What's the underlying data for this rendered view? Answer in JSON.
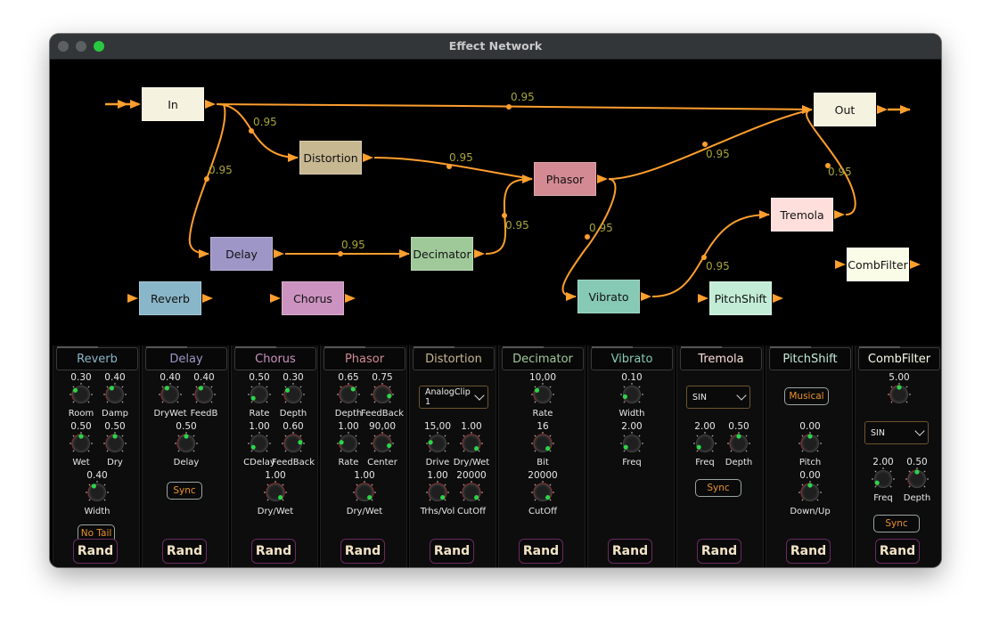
{
  "window": {
    "title": "Effect Network"
  },
  "graph": {
    "edge_color": "#ff9f2e",
    "weight_color": "#a9a53a",
    "nodes": [
      {
        "id": "In",
        "label": "In",
        "color": "#f6f2e0"
      },
      {
        "id": "Out",
        "label": "Out",
        "color": "#f6f2e0"
      },
      {
        "id": "Distortion",
        "label": "Distortion",
        "color": "#c8b892"
      },
      {
        "id": "Phasor",
        "label": "Phasor",
        "color": "#d38a93"
      },
      {
        "id": "Tremola",
        "label": "Tremola",
        "color": "#ffdfdc"
      },
      {
        "id": "Delay",
        "label": "Delay",
        "color": "#9f96c8"
      },
      {
        "id": "Decimator",
        "label": "Decimator",
        "color": "#a0c99a"
      },
      {
        "id": "CombFilter",
        "label": "CombFilter",
        "color": "#fbfce8"
      },
      {
        "id": "Reverb",
        "label": "Reverb",
        "color": "#89b6c9"
      },
      {
        "id": "Chorus",
        "label": "Chorus",
        "color": "#cc93c0"
      },
      {
        "id": "Vibrato",
        "label": "Vibrato",
        "color": "#86c9b4"
      },
      {
        "id": "PitchShift",
        "label": "PitchShift",
        "color": "#c3ecd7"
      }
    ],
    "edges": [
      {
        "from": "In",
        "to": "Out",
        "weight": "0.95"
      },
      {
        "from": "In",
        "to": "Distortion",
        "weight": "0.95"
      },
      {
        "from": "In",
        "to": "Delay",
        "weight": "0.95"
      },
      {
        "from": "Distortion",
        "to": "Phasor",
        "weight": "0.95"
      },
      {
        "from": "Delay",
        "to": "Decimator",
        "weight": "0.95"
      },
      {
        "from": "Decimator",
        "to": "Phasor",
        "weight": "0.95"
      },
      {
        "from": "Phasor",
        "to": "Out",
        "weight": "0.95"
      },
      {
        "from": "Phasor",
        "to": "Vibrato",
        "weight": "0.95"
      },
      {
        "from": "Vibrato",
        "to": "Tremola",
        "weight": "0.95"
      },
      {
        "from": "Tremola",
        "to": "Out",
        "weight": "0.95"
      }
    ]
  },
  "panels": [
    {
      "title": "Reverb",
      "color": "#89b6c9",
      "knobs": [
        {
          "label": "Room",
          "value": "0.30",
          "norm": 0.3
        },
        {
          "label": "Damp",
          "value": "0.40",
          "norm": 0.4
        },
        {
          "label": "Wet",
          "value": "0.50",
          "norm": 0.5
        },
        {
          "label": "Dry",
          "value": "0.50",
          "norm": 0.5
        },
        {
          "label": "Width",
          "value": "0.40",
          "norm": 0.4
        }
      ],
      "toggle": "No Tail",
      "rand": "Rand"
    },
    {
      "title": "Delay",
      "color": "#9f96c8",
      "knobs": [
        {
          "label": "DryWet",
          "value": "0.40",
          "norm": 0.4
        },
        {
          "label": "FeedB",
          "value": "0.40",
          "norm": 0.4
        },
        {
          "label": "Delay",
          "value": "0.50",
          "norm": 0.5
        }
      ],
      "toggle": "Sync",
      "rand": "Rand"
    },
    {
      "title": "Chorus",
      "color": "#cc93c0",
      "knobs": [
        {
          "label": "Rate",
          "value": "0.50",
          "norm": 0.05
        },
        {
          "label": "Depth",
          "value": "0.30",
          "norm": 0.3
        },
        {
          "label": "CDelay",
          "value": "1.00",
          "norm": 0.05
        },
        {
          "label": "FeedBack",
          "value": "0.60",
          "norm": 0.8
        },
        {
          "label": "Dry/Wet",
          "value": "1.00",
          "norm": 1.0
        }
      ],
      "rand": "Rand"
    },
    {
      "title": "Phasor",
      "color": "#d38a93",
      "knobs": [
        {
          "label": "Depth",
          "value": "0.65",
          "norm": 0.65
        },
        {
          "label": "FeedBack",
          "value": "0.75",
          "norm": 0.88
        },
        {
          "label": "Rate",
          "value": "1.00",
          "norm": 0.2
        },
        {
          "label": "Center",
          "value": "90,00",
          "norm": 0.9
        },
        {
          "label": "Dry/Wet",
          "value": "1.00",
          "norm": 1.0
        }
      ],
      "rand": "Rand"
    },
    {
      "title": "Distortion",
      "color": "#c8b892",
      "select": "AnalogClip 1",
      "knobs": [
        {
          "label": "Drive",
          "value": "15,00",
          "norm": 0.2
        },
        {
          "label": "Dry/Wet",
          "value": "1.00",
          "norm": 1.0
        },
        {
          "label": "Trhs/Vol",
          "value": "1.00",
          "norm": 1.0
        },
        {
          "label": "CutOff",
          "value": "20000",
          "norm": 1.0
        }
      ],
      "rand": "Rand"
    },
    {
      "title": "Decimator",
      "color": "#a0c99a",
      "knobs": [
        {
          "label": "Rate",
          "value": "10,00",
          "norm": 0.3
        },
        {
          "label": "Bit",
          "value": "16",
          "norm": 1.0
        },
        {
          "label": "CutOff",
          "value": "20000",
          "norm": 1.0
        }
      ],
      "rand": "Rand"
    },
    {
      "title": "Vibrato",
      "color": "#86c9b4",
      "knobs": [
        {
          "label": "Width",
          "value": "0.10",
          "norm": 0.1
        },
        {
          "label": "Freq",
          "value": "2.00",
          "norm": 0.05
        }
      ],
      "rand": "Rand"
    },
    {
      "title": "Tremola",
      "color": "#ffdfdc",
      "select": "SIN",
      "knobs": [
        {
          "label": "Freq",
          "value": "2.00",
          "norm": 0.05
        },
        {
          "label": "Depth",
          "value": "0.50",
          "norm": 0.5
        }
      ],
      "toggle": "Sync",
      "rand": "Rand"
    },
    {
      "title": "PitchShift",
      "color": "#c3ecd7",
      "toggle": "Musical",
      "knobs": [
        {
          "label": "Pitch",
          "value": "0.00",
          "norm": 0.5
        },
        {
          "label": "Down/Up",
          "value": "0.00",
          "norm": 0.5
        }
      ],
      "rand": "Rand"
    },
    {
      "title": "CombFilter",
      "color": "#fbfce8",
      "knobs": [
        {
          "label": "",
          "value": "5.00",
          "norm": 0.5
        },
        {
          "label": "Freq",
          "value": "2.00",
          "norm": 0.05
        },
        {
          "label": "Depth",
          "value": "0.50",
          "norm": 0.5
        }
      ],
      "select": "SIN",
      "toggle": "Sync",
      "rand": "Rand"
    }
  ]
}
